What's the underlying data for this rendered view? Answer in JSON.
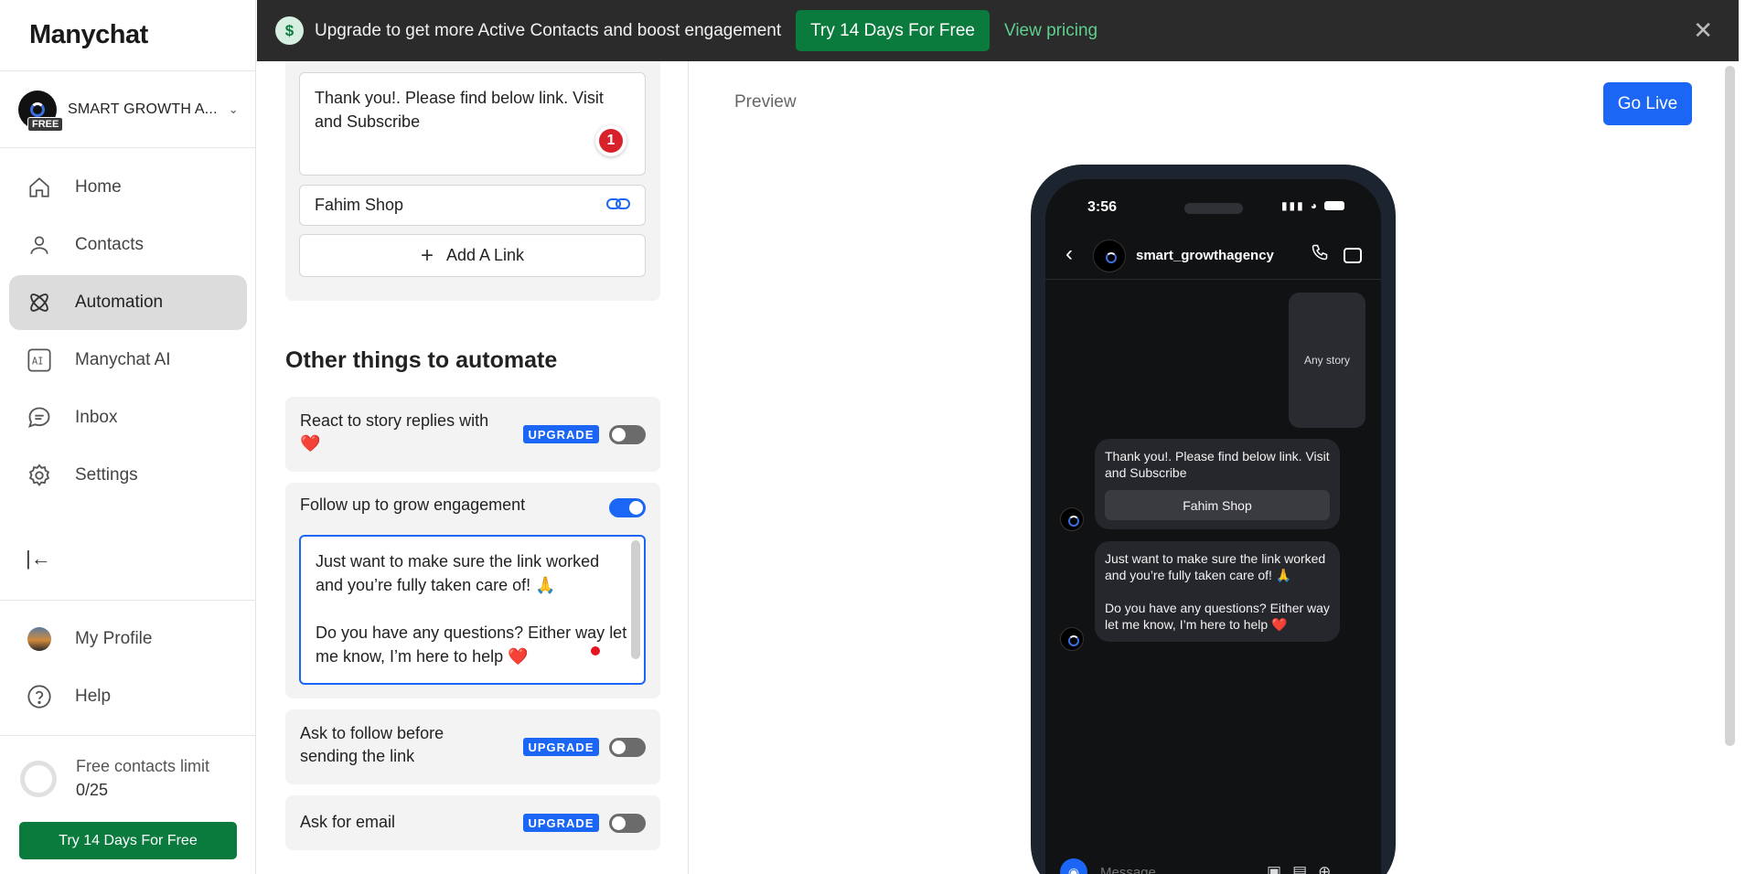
{
  "sidebar": {
    "logo": "Manychat",
    "account_name": "SMART GROWTH A...",
    "free_badge": "FREE",
    "nav": [
      {
        "label": "Home",
        "icon": "home-icon"
      },
      {
        "label": "Contacts",
        "icon": "user-icon"
      },
      {
        "label": "Automation",
        "icon": "atom-icon"
      },
      {
        "label": "Manychat AI",
        "icon": "ai-icon"
      },
      {
        "label": "Inbox",
        "icon": "chat-bubble-icon"
      },
      {
        "label": "Settings",
        "icon": "gear-icon"
      }
    ],
    "profile": "My Profile",
    "help": "Help",
    "limit_title": "Free contacts limit",
    "limit_value": "0/25",
    "try_button": "Try 14 Days For Free"
  },
  "banner": {
    "text": "Upgrade to get more Active Contacts and boost engagement",
    "try_button": "Try 14 Days For Free",
    "view_pricing": "View pricing"
  },
  "editor": {
    "message_text": "Thank you!. Please find below link. Visit and Subscribe",
    "comment_count": "1",
    "link_name": "Fahim Shop",
    "add_link": "Add A Link",
    "section_title": "Other things to automate",
    "options": [
      {
        "label": "React to story replies with ❤️",
        "badge": "UPGRADE",
        "enabled": false
      },
      {
        "label": "Follow up to grow engagement",
        "enabled": true
      },
      {
        "label": "Ask to follow before sending the link",
        "badge": "UPGRADE",
        "enabled": false
      },
      {
        "label": "Ask for email",
        "badge": "UPGRADE",
        "enabled": false
      }
    ],
    "followup_line1": "Just want to make sure the link worked and you’re fully taken care of! 🙏",
    "followup_line2": "Do you have any questions? Either way let me know, I’m here to help ❤️"
  },
  "preview": {
    "label": "Preview",
    "go_live": "Go Live",
    "time": "3:56",
    "username": "smart_growthagency",
    "story_label": "Any story",
    "bot_message": "Thank you!. Please find below link. Visit and Subscribe",
    "button_label": "Fahim Shop",
    "followup_line1": "Just want to make sure the link worked and you’re fully taken care of! 🙏",
    "followup_line2": "Do you have any questions? Either way let me know, I’m here to help ❤️",
    "message_placeholder": "Message..."
  },
  "colors": {
    "accent": "#1b66f5",
    "brand_green": "#0a7a3d",
    "banner_bg": "#2b2b2b"
  }
}
